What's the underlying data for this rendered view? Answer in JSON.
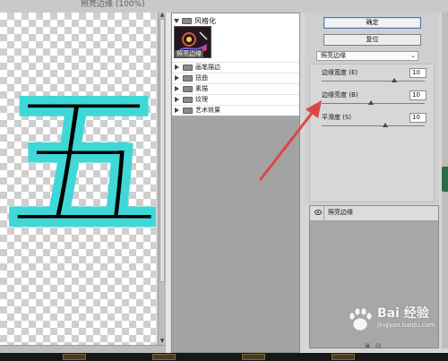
{
  "window": {
    "title": "照亮边缘 (100%)"
  },
  "preview": {
    "character": "五",
    "outline_color": "#3fd8d8"
  },
  "gallery": {
    "open_category": {
      "label": "风格化",
      "thumb_caption": "照亮边缘"
    },
    "categories": [
      {
        "label": "画笔描边"
      },
      {
        "label": "扭曲"
      },
      {
        "label": "素描"
      },
      {
        "label": "纹理"
      },
      {
        "label": "艺术效果"
      }
    ]
  },
  "buttons": {
    "ok": "确定",
    "reset": "复位"
  },
  "filter_select": {
    "value": "照亮边缘"
  },
  "params": [
    {
      "label": "边缘宽度 (E)",
      "value": "10",
      "slider_fraction": 0.7
    },
    {
      "label": "边缘亮度 (B)",
      "value": "10",
      "slider_fraction": 0.48
    },
    {
      "label": "平滑度 (S)",
      "value": "10",
      "slider_fraction": 0.62
    }
  ],
  "layers": [
    {
      "label": "照亮边缘",
      "visible": true
    }
  ],
  "watermark": {
    "main": "Bai 经验",
    "sub": "jingyan.baidu.com"
  },
  "colors": {
    "annotation_arrow": "#e04545",
    "scrollbar_accent": "#2e6b47"
  }
}
